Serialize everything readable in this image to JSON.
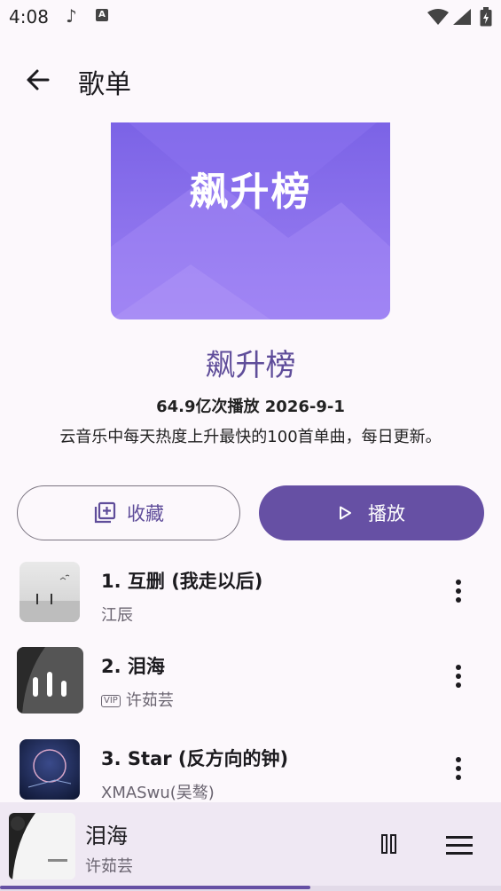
{
  "status_bar": {
    "time": "4:08",
    "icons": [
      "music-note-icon",
      "a-icon",
      "wifi-icon",
      "cell-signal-icon",
      "battery-icon"
    ]
  },
  "app_bar": {
    "title": "歌单",
    "back_icon": "arrow-left-icon"
  },
  "playlist": {
    "cover_text": "飙升榜",
    "name": "飙升榜",
    "meta": "64.9亿次播放 2026-9-1",
    "description": "云音乐中每天热度上升最快的100首单曲，每日更新。"
  },
  "actions": {
    "favorite_label": "收藏",
    "play_label": "播放"
  },
  "songs": [
    {
      "title": "1. 互删 (我走以后)",
      "artist": "江辰",
      "vip": false
    },
    {
      "title": "2. 泪海",
      "artist": "许茹芸",
      "vip": true,
      "vip_label": "VIP",
      "playing": true
    },
    {
      "title": "3. Star (反方向的钟)",
      "artist": "XMASwu(吴骜)",
      "vip": false
    }
  ],
  "now_playing": {
    "title": "泪海",
    "artist": "许茹芸",
    "progress": 0.62
  },
  "colors": {
    "accent": "#6650a4",
    "accent_text": "#5f4d9a",
    "background": "#fcf8fc",
    "player_bg": "#efe8f3"
  }
}
